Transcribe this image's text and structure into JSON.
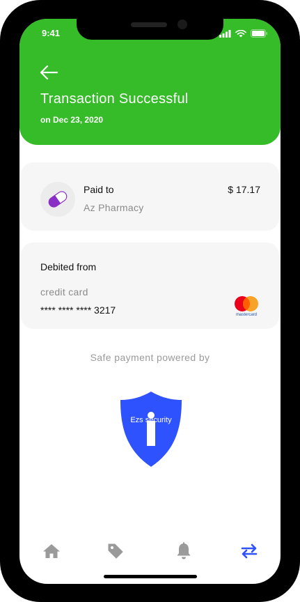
{
  "status_bar": {
    "time": "9:41"
  },
  "header": {
    "title": "Transaction Successful",
    "date": "on Dec 23, 2020",
    "back_icon": "arrow-left-icon"
  },
  "paid_card": {
    "label": "Paid to",
    "payee": "Az Pharmacy",
    "amount": "$ 17.17",
    "icon": "pill-icon"
  },
  "debit_card": {
    "label": "Debited from",
    "card_type": "credit card",
    "card_number": "**** **** **** 3217",
    "brand": "mastercard"
  },
  "security": {
    "label": "Safe payment powered by",
    "provider": "Ezs security"
  },
  "nav": {
    "items": [
      {
        "name": "home",
        "icon": "home-icon"
      },
      {
        "name": "offers",
        "icon": "tag-icon"
      },
      {
        "name": "notifications",
        "icon": "bell-icon"
      },
      {
        "name": "transactions",
        "icon": "transfer-icon",
        "active": true
      }
    ]
  },
  "colors": {
    "accent_green": "#36bb29",
    "shield_blue": "#2f52ff",
    "active_nav": "#2f52ff",
    "inactive_nav": "#9a9a9a",
    "pill_purple": "#8a2fc5"
  }
}
